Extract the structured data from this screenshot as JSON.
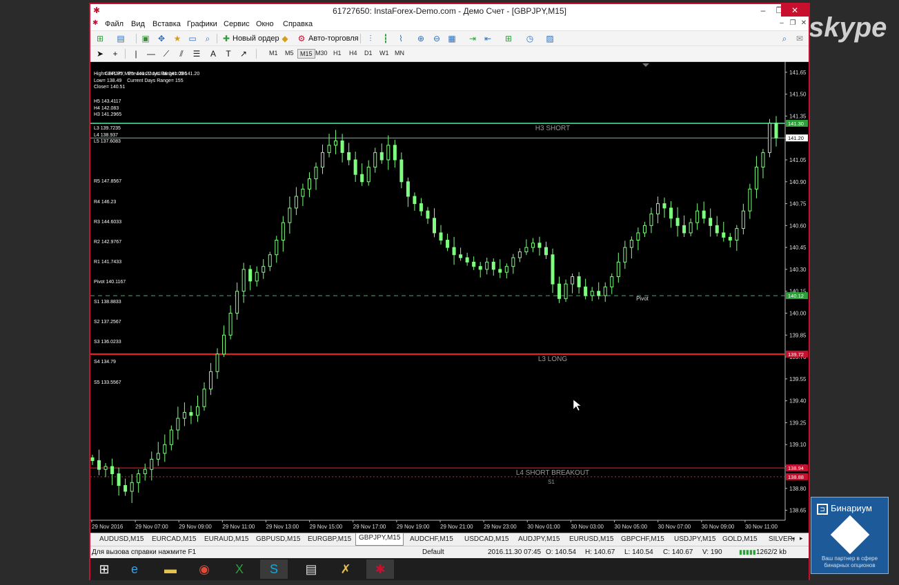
{
  "window": {
    "title": "61727650: InstaForex-Demo.com - Демо Счет - [GBPJPY,M15]",
    "buttons": {
      "minimize": "‒",
      "restore": "❐",
      "close": "✕"
    }
  },
  "menu": [
    "Файл",
    "Вид",
    "Вставка",
    "Графики",
    "Сервис",
    "Окно",
    "Справка"
  ],
  "toolbar": {
    "new_order": "Новый ордер",
    "auto_trading": "Авто-торговля",
    "timeframes": [
      "M1",
      "M5",
      "M15",
      "M30",
      "H1",
      "H4",
      "D1",
      "W1",
      "MN"
    ],
    "active_timeframe": "M15"
  },
  "chart": {
    "header": "GBPJPY,M15  141.27 141.36 141.09 141.20",
    "info_lines": [
      "High= 141.35    Previous Days Range= 286",
      "Low= 138.49    Current Days Range= 155",
      "Close= 140.51"
    ],
    "h_lines": [
      "H5 143.4117",
      "H4 142.083",
      "H3 141.2965"
    ],
    "l_lines": [
      "L3 139.7235",
      "L4 138.937",
      "L5 137.6083"
    ],
    "pivots": [
      "R5 147.8567",
      "R4 146.23",
      "R3 144.6033",
      "R2 142.9767",
      "R1 141.7433",
      "Pivot 140.1167",
      "S1 138.8833",
      "S2 137.2567",
      "S3 136.0233",
      "S4 134.79",
      "S5 133.5567"
    ],
    "level_labels": {
      "h3": "H3 SHORT",
      "l3": "L3 LONG",
      "l4": "L4 SHORT BREAKOUT",
      "s1": "S1",
      "pivot": "Pivot"
    },
    "price_ticks": [
      "141.65",
      "141.50",
      "141.35",
      "141.20",
      "141.05",
      "140.90",
      "140.75",
      "140.60",
      "140.45",
      "140.30",
      "140.15",
      "140.00",
      "139.85",
      "139.70",
      "139.55",
      "139.40",
      "139.25",
      "139.10",
      "138.95",
      "138.80",
      "138.65"
    ],
    "price_badges": {
      "h3": "141.30",
      "current": "141.20",
      "pivot": "140.12",
      "l3": "139.72",
      "l4": "138.94",
      "s1": "138.88"
    },
    "time_ticks": [
      "29 Nov 2016",
      "29 Nov 07:00",
      "29 Nov 09:00",
      "29 Nov 11:00",
      "29 Nov 13:00",
      "29 Nov 15:00",
      "29 Nov 17:00",
      "29 Nov 19:00",
      "29 Nov 21:00",
      "29 Nov 23:00",
      "30 Nov 01:00",
      "30 Nov 03:00",
      "30 Nov 05:00",
      "30 Nov 07:00",
      "30 Nov 09:00",
      "30 Nov 11:00"
    ],
    "colors": {
      "candle": "#7fff7f",
      "h3": "#3cb371",
      "l3": "#ff2020",
      "l4": "#ff2020",
      "pivot": "#3cb371",
      "current": "#ffffff"
    }
  },
  "chart_data": {
    "type": "candlestick",
    "symbol": "GBPJPY",
    "timeframe": "M15",
    "ylim": [
      138.6,
      141.7
    ],
    "closes": [
      138.99,
      138.93,
      138.95,
      138.9,
      138.82,
      138.78,
      138.84,
      138.9,
      138.93,
      139.0,
      139.04,
      139.1,
      139.2,
      139.28,
      139.32,
      139.3,
      139.36,
      139.48,
      139.6,
      139.72,
      139.85,
      140.0,
      140.15,
      140.3,
      140.22,
      140.28,
      140.32,
      140.4,
      140.5,
      140.62,
      140.72,
      140.8,
      140.85,
      140.92,
      141.0,
      141.1,
      141.15,
      141.18,
      141.1,
      141.05,
      140.95,
      140.9,
      141.0,
      141.1,
      141.05,
      141.15,
      141.05,
      140.9,
      140.8,
      140.75,
      140.7,
      140.65,
      140.55,
      140.5,
      140.45,
      140.4,
      140.38,
      140.35,
      140.32,
      140.3,
      140.35,
      140.3,
      140.28,
      140.32,
      140.38,
      140.42,
      140.45,
      140.48,
      140.45,
      140.4,
      140.2,
      140.1,
      140.2,
      140.25,
      140.18,
      140.12,
      140.15,
      140.12,
      140.18,
      140.25,
      140.35,
      140.45,
      140.5,
      140.55,
      140.6,
      140.68,
      140.75,
      140.72,
      140.65,
      140.6,
      140.55,
      140.62,
      140.7,
      140.65,
      140.6,
      140.55,
      140.52,
      140.5,
      140.58,
      140.7,
      140.85,
      141.0,
      141.1,
      141.3,
      141.2
    ]
  },
  "symbol_tabs": [
    "AUDUSD,M15",
    "EURCAD,M15",
    "EURAUD,M15",
    "GBPUSD,M15",
    "EURGBP,M15",
    "GBPJPY,M15",
    "AUDCHF,M15",
    "USDCAD,M15",
    "AUDJPY,M15",
    "EURUSD,M15",
    "GBPCHF,M15",
    "USDJPY,M15",
    "GOLD,M15",
    "SILVER,"
  ],
  "active_tab": "GBPJPY,M15",
  "status": {
    "help": "Для вызова справки нажмите F1",
    "profile": "Default",
    "datetime": "2016.11.30 07:45",
    "open": "O: 140.54",
    "high": "H: 140.67",
    "low": "L: 140.54",
    "close": "C: 140.67",
    "volume": "V: 190",
    "traffic": "1262/2 kb"
  },
  "overlay": {
    "skype": "skype",
    "binarium_title": "Бинариум",
    "binarium_tagline": "Ваш партнер в сфере бинарных опционов"
  }
}
